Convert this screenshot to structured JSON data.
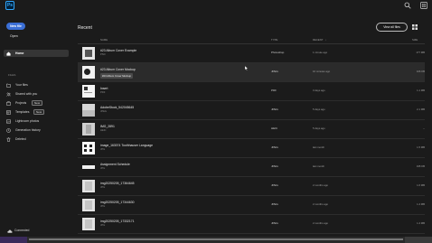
{
  "app": {
    "logo_text": "Ps",
    "accent": "#31a8ff",
    "button_color": "#3b6fd6"
  },
  "sidebar": {
    "new_file_label": "New file",
    "open_label": "Open",
    "home_label": "Home",
    "section_label": "FILES",
    "items": [
      {
        "label": "Your files",
        "icon": "folder-icon"
      },
      {
        "label": "Shared with you",
        "icon": "people-icon"
      },
      {
        "label": "Projects",
        "icon": "projects-icon",
        "badge": "New"
      },
      {
        "label": "Templates",
        "icon": "templates-icon",
        "badge": "New"
      },
      {
        "label": "Lightroom photos",
        "icon": "lightroom-icon"
      },
      {
        "label": "Generation history",
        "icon": "history-icon"
      },
      {
        "label": "Deleted",
        "icon": "trash-icon"
      }
    ],
    "status_label": "Connected"
  },
  "main": {
    "title": "Recent",
    "view_all_label": "View all files",
    "columns": {
      "name": "NAME",
      "type": "TYPE",
      "recent": "RECENT",
      "size": "SIZE"
    },
    "sort_indicator": "↓",
    "tooltip": "#23 Album Cover Mockup",
    "files": [
      {
        "name": "#23 Album Cover Example",
        "ext": "PSD",
        "type": "Photoshop",
        "date": "1 minute ago",
        "size": "177 MB"
      },
      {
        "name": "#23 Album Cover Mockup",
        "ext": "JPG",
        "type": "JPEG",
        "date": "16 minutes ago",
        "size": "106 KB"
      },
      {
        "name": "Insert",
        "ext": "PDF",
        "type": "PDF",
        "date": "3 days ago",
        "size": "1.1 MB"
      },
      {
        "name": "AdobeStock_542045645",
        "ext": "JPEG",
        "type": "JPEG",
        "date": "5 days ago",
        "size": "2.1 MB"
      },
      {
        "name": "IMG_2891",
        "ext": "HEIC",
        "type": "HEIC",
        "date": "5 days ago",
        "size": "--"
      },
      {
        "name": "image_163074 Toothhauser Language",
        "ext": "JPG",
        "type": "JPEG",
        "date": "last month",
        "size": "1.5 MB"
      },
      {
        "name": "Assignment Schedule",
        "ext": "JPG",
        "type": "JPEG",
        "date": "last month",
        "size": "195 KB"
      },
      {
        "name": "img20250205_17364645",
        "ext": "JPG",
        "type": "JPEG",
        "date": "2 months ago",
        "size": "1.6 MB"
      },
      {
        "name": "img20250205_17344630",
        "ext": "JPG",
        "type": "JPEG",
        "date": "2 months ago",
        "size": "1.4 MB"
      },
      {
        "name": "img20250205_17332171",
        "ext": "JPG",
        "type": "JPEG",
        "date": "2 months ago",
        "size": "1.4 MB"
      }
    ]
  }
}
